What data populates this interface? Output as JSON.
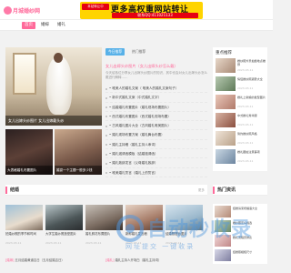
{
  "header": {
    "logo_text": "月城婚纱网",
    "banner_badge": "本站转让中",
    "banner_title": "更多高权重网站转让",
    "banner_contact": "联系QQ:411021133"
  },
  "nav": {
    "items": [
      "首页",
      "婚嫁",
      "婚礼"
    ],
    "active_index": 0
  },
  "hero": {
    "caption": "女儿出嫁头纱图片 女儿出嫁戴头纱"
  },
  "thumbs": [
    {
      "caption": "大表格婚礼布置图片"
    },
    {
      "caption": "婚宴一个主题一般多少钱"
    }
  ],
  "center": {
    "tabs": [
      "今日推荐",
      "热门推荐"
    ],
    "feature_title": "女儿出嫁头纱图片（女儿出嫁头纱怎么戴）",
    "feature_desc": "今天给各位分享女儿出嫁头纱图片的知识，其中也会对女儿出嫁头纱怎么戴进行解释……",
    "list": [
      "• 唯美人的婚礼文案（ 唯美人的婚礼文案句子）",
      "• 新中式婚礼文案（中式婚礼文字）",
      "• 结婚婚礼布置图片（婚礼现场布置图片）",
      "• 西式婚礼布置图片（西式婚礼现场布置）",
      "• 古风婚礼图片大全（古风婚礼唯美图片）",
      "• 婚礼现场布置方案（婚礼舞台布置）",
      "• 婚礼主持稿（婚礼主持人串词）",
      "• 婚礼邀请函模板（结婚邀请函）",
      "• 婚礼致辞发言（父母婚礼致辞）",
      "• 唯美婚礼誓言（婚礼上的誓言）"
    ]
  },
  "sidebar": {
    "title": "重点推荐",
    "items": [
      {
        "text": "婚纱照外景拍摄地点推荐",
        "date": "2023-03-11"
      },
      {
        "text": "情侣婚纱照姿势大全",
        "date": "2023-03-11"
      },
      {
        "text": "婚礼上新娘的发型图片",
        "date": "2023-03-11"
      },
      {
        "text": "中式婚礼秀禾服",
        "date": "2023-03-11"
      },
      {
        "text": "简约婚纱照风格",
        "date": "2023-03-11"
      },
      {
        "text": "婚礼跟拍注意事项",
        "date": "2023-03-11"
      }
    ]
  },
  "sections": {
    "left_title": "结婚",
    "left_more": "更多",
    "right_title": "热门资讯",
    "right_more": "更多"
  },
  "cards": [
    {
      "title": "拍婚纱照的季节和时间",
      "date": "2023-03-11"
    },
    {
      "title": "大学生婚纱照造型图片",
      "date": "2023-03-11"
    },
    {
      "title": "婚礼鲜花布置图片",
      "date": "2023-03-11"
    },
    {
      "title": "新郎婚礼发言稿",
      "date": "2023-03-11"
    },
    {
      "title": "结婚照摆台图片",
      "date": "2023-03-11"
    }
  ],
  "hot": [
    {
      "text": "结婚请柬祝福语大全"
    },
    {
      "text": "婚纱照怎么挑选"
    },
    {
      "text": "婚礼流程安排表"
    },
    {
      "text": "结婚照相框尺寸"
    }
  ],
  "bottom_links": [
    {
      "tag": "[婚嫁]",
      "text": "五月结婚黄道吉日（五月结婚吉日）"
    },
    {
      "tag": "[婚礼]",
      "text": "婚礼主持人开场白（婚礼主持词）"
    }
  ],
  "watermark": {
    "text": "自动秒收录",
    "sub": "网址提交 一键收录"
  },
  "colors": {
    "accent": "#ff6a9a",
    "tab_active": "#58b1e8",
    "banner": "#ffd400",
    "banner_red": "#e60012"
  }
}
